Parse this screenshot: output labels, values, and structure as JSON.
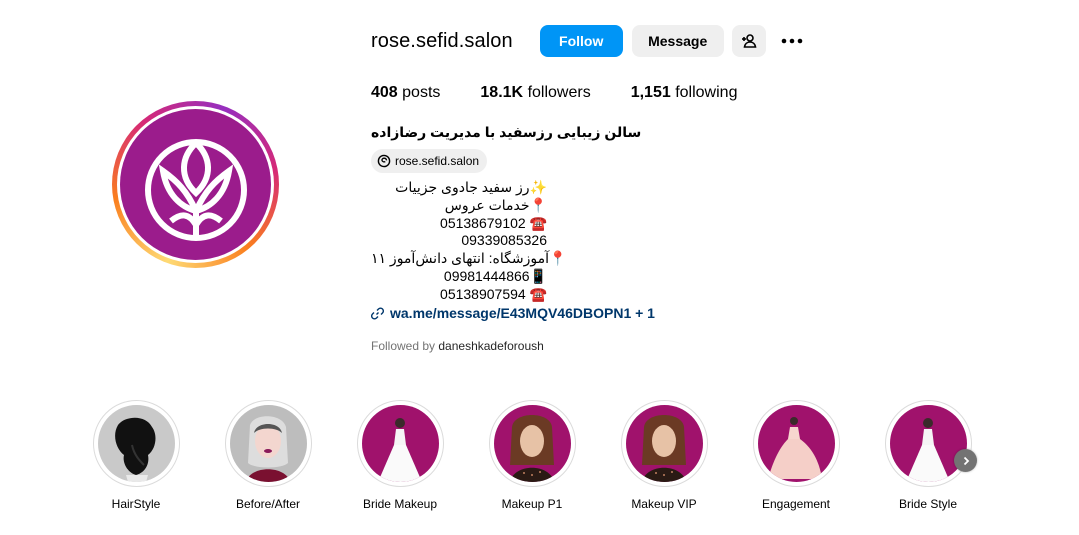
{
  "profile": {
    "username": "rose.sefid.salon",
    "follow_label": "Follow",
    "message_label": "Message",
    "add_user_icon": "add-user-icon",
    "more_icon": "more-options-icon"
  },
  "stats": {
    "posts_count": "408",
    "posts_label": "posts",
    "followers_count": "18.1K",
    "followers_label": "followers",
    "following_count": "1,151",
    "following_label": "following"
  },
  "bio": {
    "name": "سالن زیبایی رزسفید با مدیریت رضازاده",
    "threads_handle": "rose.sefid.salon",
    "lines": [
      "رز سفید جادوی جزییات✨",
      "خدمات عروس📍",
      "05138679102 ☎️",
      "09339085326",
      "آموزشگاه: انتهای دانش‌آموز ۱۱📍",
      "09981444866📱",
      "05138907594 ☎️"
    ],
    "link": "wa.me/message/E43MQV46DBOPN1 + 1",
    "followed_by_prefix": "Followed by",
    "followed_by_user": "daneshkadeforoush"
  },
  "highlights": [
    {
      "label": "HairStyle"
    },
    {
      "label": "Before/After"
    },
    {
      "label": "Bride Makeup"
    },
    {
      "label": "Makeup P1"
    },
    {
      "label": "Makeup VIP"
    },
    {
      "label": "Engagement"
    },
    {
      "label": "Bride Style"
    }
  ],
  "colors": {
    "brand": "#9b1c8c",
    "follow_button": "#0095f6",
    "secondary_button": "#efefef",
    "link": "#00376b"
  }
}
